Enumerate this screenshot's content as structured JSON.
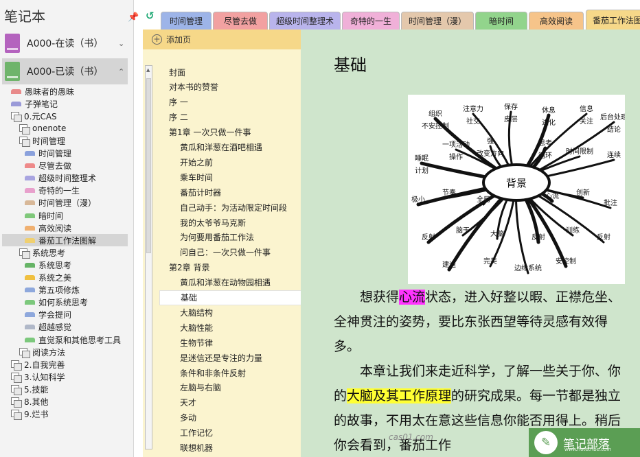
{
  "notebook_pane": {
    "title": "笔记本",
    "pin_icon": "pin-icon",
    "notebooks": [
      {
        "label": "A000-在读（书）",
        "color": "#b463be",
        "chevron": "⌄",
        "active": false
      },
      {
        "label": "A000-已读（书）",
        "color": "#6fb46b",
        "chevron": "⌃",
        "active": true
      }
    ],
    "tree": [
      {
        "label": "愚昧者的愚昧",
        "type": "section",
        "color": "#e88a8a",
        "indent": 1
      },
      {
        "label": "子弹笔记",
        "type": "section",
        "color": "#9a9ad8",
        "indent": 1
      },
      {
        "label": "0.元CAS",
        "type": "group",
        "indent": 1
      },
      {
        "label": "onenote",
        "type": "group",
        "indent": 2
      },
      {
        "label": "时间管理",
        "type": "group",
        "indent": 2
      },
      {
        "label": "时间管理",
        "type": "section",
        "color": "#8aa1dc",
        "indent": 3
      },
      {
        "label": "尽管去做",
        "type": "section",
        "color": "#ee8a8a",
        "indent": 3
      },
      {
        "label": "超级时间整理术",
        "type": "section",
        "color": "#a8a4e0",
        "indent": 3
      },
      {
        "label": "奇特的一生",
        "type": "section",
        "color": "#e8a0cc",
        "indent": 3
      },
      {
        "label": "时间管理（漫）",
        "type": "section",
        "color": "#d8b898",
        "indent": 3
      },
      {
        "label": "暗时间",
        "type": "section",
        "color": "#7fc87a",
        "indent": 3
      },
      {
        "label": "高效阅读",
        "type": "section",
        "color": "#f0b070",
        "indent": 3
      },
      {
        "label": "番茄工作法图解",
        "type": "section",
        "color": "#f0d070",
        "indent": 3,
        "selected": true
      },
      {
        "label": "系统思考",
        "type": "group",
        "indent": 2
      },
      {
        "label": "系统思考",
        "type": "section",
        "color": "#66b466",
        "indent": 3
      },
      {
        "label": "系统之美",
        "type": "section",
        "color": "#f0c040",
        "indent": 3
      },
      {
        "label": "第五项修炼",
        "type": "section",
        "color": "#8ea8dc",
        "indent": 3
      },
      {
        "label": "如何系统思考",
        "type": "section",
        "color": "#7cc87c",
        "indent": 3
      },
      {
        "label": "学会提问",
        "type": "section",
        "color": "#8ea8dc",
        "indent": 3
      },
      {
        "label": "超越感觉",
        "type": "section",
        "color": "#b0b8c8",
        "indent": 3
      },
      {
        "label": "直觉泵和其他思考工具",
        "type": "section",
        "color": "#7cc87c",
        "indent": 3
      },
      {
        "label": "阅读方法",
        "type": "group",
        "indent": 2
      },
      {
        "label": "2.自我完善",
        "type": "group",
        "indent": 1
      },
      {
        "label": "3.认知科学",
        "type": "group",
        "indent": 1
      },
      {
        "label": "5.技能",
        "type": "group",
        "indent": 1
      },
      {
        "label": "8.其他",
        "type": "group",
        "indent": 1
      },
      {
        "label": "9.烂书",
        "type": "group",
        "indent": 1
      }
    ]
  },
  "toolbar": {
    "back_icon": "back-arrow-icon",
    "back_glyph": "↺"
  },
  "tabs": [
    {
      "label": "时间管理",
      "color": "#9db4e8"
    },
    {
      "label": "尽管去做",
      "color": "#f2a1a1"
    },
    {
      "label": "超级时间整理术",
      "color": "#b9b4ec"
    },
    {
      "label": "奇特的一生",
      "color": "#f0b0d8"
    },
    {
      "label": "时间管理（漫）",
      "color": "#e4c8ac"
    },
    {
      "label": "暗时间",
      "color": "#92d48c"
    },
    {
      "label": "高效阅读",
      "color": "#f6c48a"
    },
    {
      "label": "番茄工作法图解",
      "color": "#f6d889",
      "active": true
    }
  ],
  "page_list": {
    "add_label": "添加页",
    "add_icon": "plus-circle-icon",
    "pages": [
      {
        "label": "封面",
        "level": 1
      },
      {
        "label": "对本书的赞誉",
        "level": 1
      },
      {
        "label": "序 一",
        "level": 1
      },
      {
        "label": "序 二",
        "level": 1
      },
      {
        "label": "第1章 一次只做一件事",
        "level": 1
      },
      {
        "label": "黄瓜和洋葱在酒吧相遇",
        "level": 2
      },
      {
        "label": "开始之前",
        "level": 2
      },
      {
        "label": "乘车时间",
        "level": 2
      },
      {
        "label": "番茄计时器",
        "level": 2
      },
      {
        "label": "自己动手：为活动限定时间段",
        "level": 2
      },
      {
        "label": "我的太爷爷马克斯",
        "level": 2
      },
      {
        "label": "为何要用番茄工作法",
        "level": 2
      },
      {
        "label": "问自己：一次只做一件事",
        "level": 2
      },
      {
        "label": "第2章 背景",
        "level": 1
      },
      {
        "label": "黄瓜和洋葱在动物园相遇",
        "level": 2
      },
      {
        "label": "基础",
        "level": 2,
        "selected": true
      },
      {
        "label": "大脑结构",
        "level": 2
      },
      {
        "label": "大脑性能",
        "level": 2
      },
      {
        "label": "生物节律",
        "level": 2
      },
      {
        "label": "是迷信还是专注的力量",
        "level": 2
      },
      {
        "label": "条件和非条件反射",
        "level": 2
      },
      {
        "label": "左脑与右脑",
        "level": 2
      },
      {
        "label": "天才",
        "level": 2
      },
      {
        "label": "多动",
        "level": 2
      },
      {
        "label": "工作记忆",
        "level": 2
      },
      {
        "label": "联想机器",
        "level": 2
      }
    ]
  },
  "content": {
    "title": "基础",
    "mindmap": {
      "center": "背景",
      "labels": [
        "组织",
        "注意力",
        "保存",
        "休息",
        "信息",
        "后台处理",
        "睡眠",
        "一项活动",
        "强",
        "思考",
        "时间限制",
        "连续",
        "极小",
        "节奏",
        "全局",
        "心流",
        "创新",
        "批注",
        "反射",
        "脑干",
        "大脑",
        "反射",
        "训练",
        "反射",
        "建造",
        "完美",
        "边缘系统",
        "安控制",
        "不安控制",
        "社交",
        "皮层",
        "进化",
        "关注",
        "结论",
        "计划",
        "操作",
        "改变方向",
        "循环"
      ]
    },
    "para1": {
      "pre": "想获得",
      "hl": "心流",
      "post": "状态，进入好整以暇、正襟危坐、全神贯注的姿势，要比东张西望等待灵感有效得多。"
    },
    "para2": {
      "pre": "本章让我们来走近科学，了解一些关于你、你的",
      "hl": "大脑及其工作原理",
      "post": "的研究成果。每一节都是独立的故事，不用太在意这些信息你能否用得上。稍后你会看到，番茄工作"
    },
    "watermark": "cas01.com"
  },
  "logo": {
    "text": "笔记部落",
    "sub": "www.notetribe.com",
    "icon": "pencil-icon",
    "glyph": "✎"
  }
}
